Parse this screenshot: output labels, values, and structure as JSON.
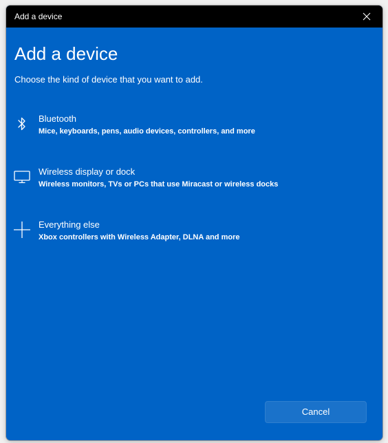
{
  "window": {
    "title": "Add a device"
  },
  "heading": "Add a device",
  "subtitle": "Choose the kind of device that you want to add.",
  "options": [
    {
      "icon": "bluetooth-icon",
      "title": "Bluetooth",
      "description": "Mice, keyboards, pens, audio devices, controllers, and more"
    },
    {
      "icon": "monitor-icon",
      "title": "Wireless display or dock",
      "description": "Wireless monitors, TVs or PCs that use Miracast or wireless docks"
    },
    {
      "icon": "plus-icon",
      "title": "Everything else",
      "description": "Xbox controllers with Wireless Adapter, DLNA and more"
    }
  ],
  "cancel_label": "Cancel",
  "colors": {
    "background": "#0063c6",
    "titlebar": "#000000",
    "button": "#1a72ca",
    "text": "#ffffff"
  }
}
